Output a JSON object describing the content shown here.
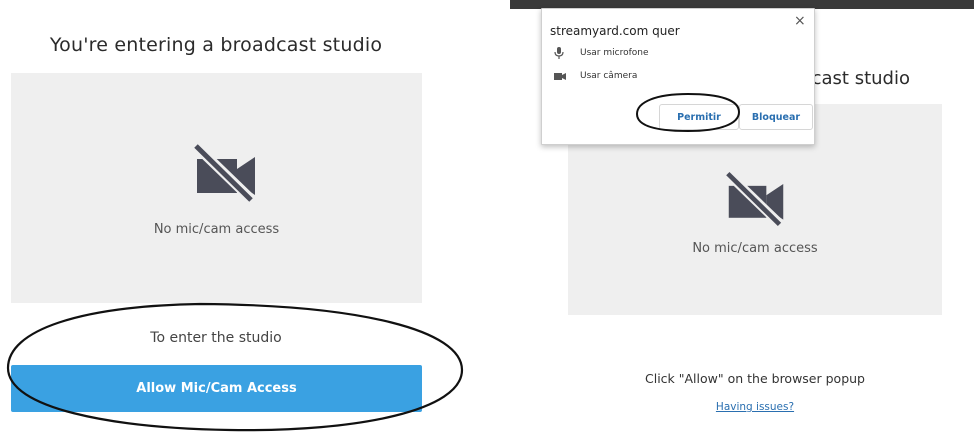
{
  "left": {
    "title": "You're entering a broadcast studio",
    "preview_text": "No mic/cam access",
    "enter_text": "To enter the studio",
    "allow_button": "Allow Mic/Cam Access"
  },
  "right": {
    "title_partial": "cast studio",
    "preview_text": "No mic/cam access",
    "instruction": "Click \"Allow\" on the browser popup",
    "help_link": "Having issues?"
  },
  "popup": {
    "title": "streamyard.com quer",
    "close_glyph": "×",
    "permissions": [
      {
        "label": "Usar microfone",
        "icon": "microphone-icon"
      },
      {
        "label": "Usar câmera",
        "icon": "camera-icon"
      }
    ],
    "allow_label": "Permitir",
    "block_label": "Bloquear"
  },
  "colors": {
    "accent": "#3aa1e2",
    "preview_bg": "#efefef",
    "icon": "#4a4c59",
    "link": "#2a6fb0"
  }
}
